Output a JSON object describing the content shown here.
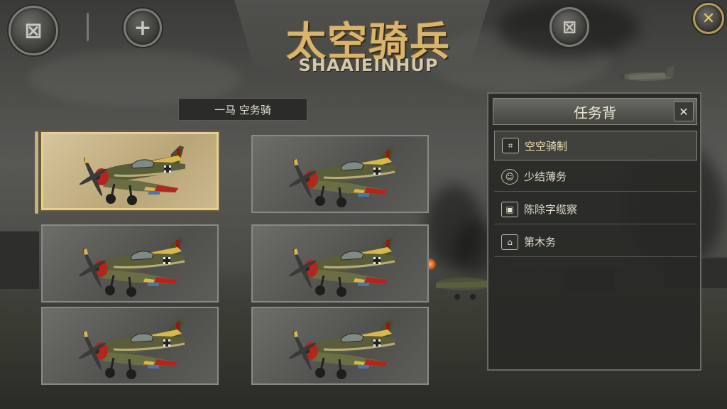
{
  "header": {
    "title": "太空骑兵",
    "subtitle": "SHAAIEINHUP",
    "left_button_glyph": "⊠",
    "add_button_glyph": "+",
    "right_button_glyph": "⊠",
    "close_button_glyph": "✕"
  },
  "category_tab": {
    "label": "一马  空务骑"
  },
  "aircraft_cards": [
    {
      "icon": "fighter-plane",
      "selected": true
    },
    {
      "icon": "fighter-plane",
      "selected": false
    },
    {
      "icon": "fighter-plane",
      "selected": false
    },
    {
      "icon": "fighter-plane",
      "selected": false
    },
    {
      "icon": "fighter-plane",
      "selected": false
    },
    {
      "icon": "fighter-plane",
      "selected": false
    }
  ],
  "mission_panel": {
    "title": "任务背",
    "close_glyph": "✕",
    "items": [
      {
        "label": "空空骑制",
        "icon": "grid-icon",
        "active": true
      },
      {
        "label": "少结薄务",
        "icon": "pilot-icon",
        "active": false
      },
      {
        "label": "陈除字缆察",
        "icon": "radio-icon",
        "active": false
      },
      {
        "label": "第木务",
        "icon": "hangar-icon",
        "active": false
      }
    ]
  },
  "colors": {
    "title_gold": "#d8b56e",
    "selected_card": "#cbb98f",
    "plane_olive": "#5a5d3a",
    "plane_nose_red": "#b3261e",
    "wing_stripe_yellow": "#d9b84a"
  }
}
